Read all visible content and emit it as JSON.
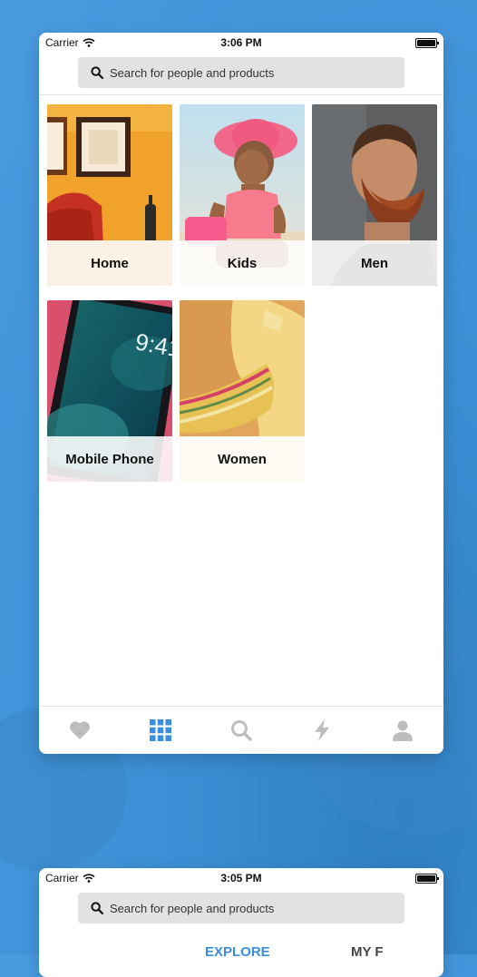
{
  "screen1": {
    "status": {
      "carrier": "Carrier",
      "time": "3:06 PM"
    },
    "search": {
      "placeholder": "Search for people and products"
    },
    "categories": [
      {
        "label": "Home",
        "image": "living-room-photo"
      },
      {
        "label": "Kids",
        "image": "baby-with-pink-hat-photo"
      },
      {
        "label": "Men",
        "image": "bearded-man-photo"
      },
      {
        "label": "Mobile Phone",
        "image": "smartphone-photo"
      },
      {
        "label": "Women",
        "image": "woman-necklace-photo"
      }
    ],
    "tabbar": {
      "items": [
        {
          "icon": "heart-icon",
          "active": false
        },
        {
          "icon": "grid-icon",
          "active": true
        },
        {
          "icon": "search-icon",
          "active": false
        },
        {
          "icon": "lightning-icon",
          "active": false
        },
        {
          "icon": "person-icon",
          "active": false
        }
      ],
      "active_color": "#3a8fdc",
      "inactive_color": "#bdbdbd"
    }
  },
  "screen2": {
    "status": {
      "carrier": "Carrier",
      "time": "3:05 PM"
    },
    "search": {
      "placeholder": "Search for people and products"
    },
    "segments": {
      "explore": "EXPLORE",
      "my": "MY F"
    },
    "accent": "#3a8fdc"
  }
}
